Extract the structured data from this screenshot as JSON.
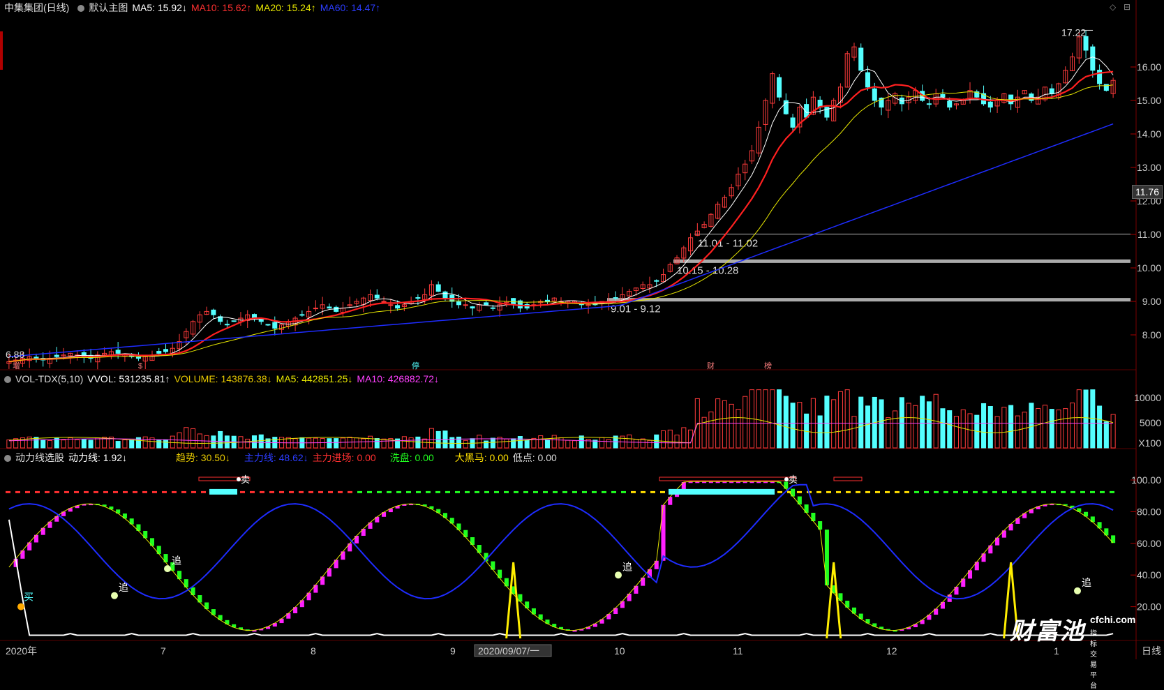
{
  "main_legend": {
    "stock": "中集集团(日线)",
    "template": "默认主图",
    "ma5": "MA5: 15.92↓",
    "ma10": "MA10: 15.62↑",
    "ma20": "MA20: 15.24↑",
    "ma60": "MA60: 14.47↑"
  },
  "vol_legend": {
    "name": "VOL-TDX(5,10)",
    "vvol": "VVOL: 531235.81↑",
    "volume": "VOLUME: 143876.38↓",
    "ma5": "MA5: 442851.25↓",
    "ma10": "MA10: 426882.72↓"
  },
  "ind_legend": {
    "name": "动力线选股",
    "line": "动力线: 1.92↓",
    "trend": "趋势: 30.50↓",
    "main": "主力线: 48.62↓",
    "inflow": "主力进场: 0.00",
    "wash": "洗盘: 0.00",
    "horse": "大黑马: 0.00",
    "low": "低点: 0.00"
  },
  "colors": {
    "up": "#ff3b3b",
    "down": "#54ffff",
    "ma5": "#ffffff",
    "ma10": "#ff2020",
    "ma20": "#e6e600",
    "ma60": "#1e2cff",
    "magenta": "#ff20ff",
    "green": "#20ff20"
  },
  "price_axis": [
    "16.00",
    "15.00",
    "14.00",
    "13.00",
    "12.00",
    "11.00",
    "10.00",
    "9.00",
    "8.00"
  ],
  "vol_axis": [
    "10000",
    "5000",
    "X100"
  ],
  "ind_axis": [
    "100.00",
    "80.00",
    "60.00",
    "40.00",
    "20.00"
  ],
  "last_price": "11.76",
  "annotations": {
    "high": "17.22",
    "low": "6.88",
    "zone1": "11.01 - 11.02",
    "zone2": "10.15 - 10.28",
    "zone3": "9.01 - 9.12",
    "buy": "买",
    "sell1": "卖",
    "sell2": "卖",
    "chase": "追"
  },
  "event_marks": [
    "增",
    "$",
    "停",
    "财",
    "榜"
  ],
  "x_labels": [
    "2020年",
    "7",
    "8",
    "9",
    "2020/09/07/一",
    "10",
    "11",
    "12",
    "1"
  ],
  "bottom_right": "日线",
  "watermark": {
    "big": "财富池",
    "url": "cfchi.com",
    "sub": "指标交易平台"
  },
  "chart_data": {
    "type": "candlestick",
    "title": "中集集团(日线)",
    "price_range": [
      6.88,
      17.22
    ],
    "price_ylim": [
      7.0,
      17.5
    ],
    "ma_series": [
      {
        "name": "MA5",
        "last": 15.92
      },
      {
        "name": "MA10",
        "last": 15.62
      },
      {
        "name": "MA20",
        "last": 15.24
      },
      {
        "name": "MA60",
        "last": 14.47
      }
    ],
    "closes": [
      7.2,
      7.25,
      7.3,
      7.35,
      7.3,
      7.25,
      7.3,
      7.35,
      7.4,
      7.45,
      7.4,
      7.35,
      7.3,
      7.4,
      7.45,
      7.5,
      7.45,
      7.4,
      7.35,
      7.3,
      7.35,
      7.4,
      7.45,
      7.5,
      7.6,
      7.8,
      8.1,
      8.4,
      8.6,
      8.7,
      8.6,
      8.4,
      8.3,
      8.4,
      8.5,
      8.6,
      8.5,
      8.4,
      8.3,
      8.2,
      8.3,
      8.4,
      8.5,
      8.6,
      8.7,
      8.8,
      8.9,
      8.8,
      8.7,
      8.8,
      8.9,
      9.0,
      9.1,
      9.2,
      9.1,
      9.0,
      8.9,
      8.8,
      8.9,
      9.0,
      9.1,
      9.2,
      9.5,
      9.3,
      9.1,
      9.0,
      8.9,
      8.9,
      8.8,
      8.9,
      8.9,
      8.8,
      8.9,
      9.0,
      8.9,
      8.8,
      8.8,
      8.9,
      9.0,
      9.0,
      9.1,
      9.0,
      9.0,
      9.0,
      8.9,
      8.9,
      8.9,
      9.0,
      9.0,
      9.1,
      9.2,
      9.3,
      9.4,
      9.5,
      9.5,
      9.6,
      9.8,
      10.1,
      10.3,
      10.6,
      10.9,
      11.1,
      11.3,
      11.6,
      11.9,
      12.1,
      12.4,
      12.8,
      13.1,
      13.5,
      14.2,
      15.0,
      15.8,
      15.1,
      14.6,
      14.2,
      14.8,
      14.5,
      15.1,
      14.8,
      14.5,
      15.0,
      15.4,
      16.4,
      16.6,
      15.9,
      15.4,
      15.0,
      14.8,
      15.0,
      15.2,
      14.9,
      15.1,
      15.3,
      15.0,
      14.9,
      15.2,
      15.1,
      14.8,
      14.9,
      15.0,
      15.3,
      15.1,
      14.9,
      14.8,
      15.0,
      15.2,
      14.9,
      15.1,
      15.3,
      15.0,
      15.1,
      15.4,
      15.2,
      15.5,
      15.9,
      16.3,
      16.9,
      16.5,
      15.9,
      15.5,
      15.3,
      15.6
    ],
    "volume_axis": [
      0,
      12000
    ],
    "indicator_axis": [
      0,
      100
    ],
    "indicator_series": [
      {
        "name": "主力线",
        "color": "blue"
      },
      {
        "name": "趋势",
        "color": "magenta/green"
      },
      {
        "name": "动力线",
        "color": "white"
      }
    ]
  }
}
